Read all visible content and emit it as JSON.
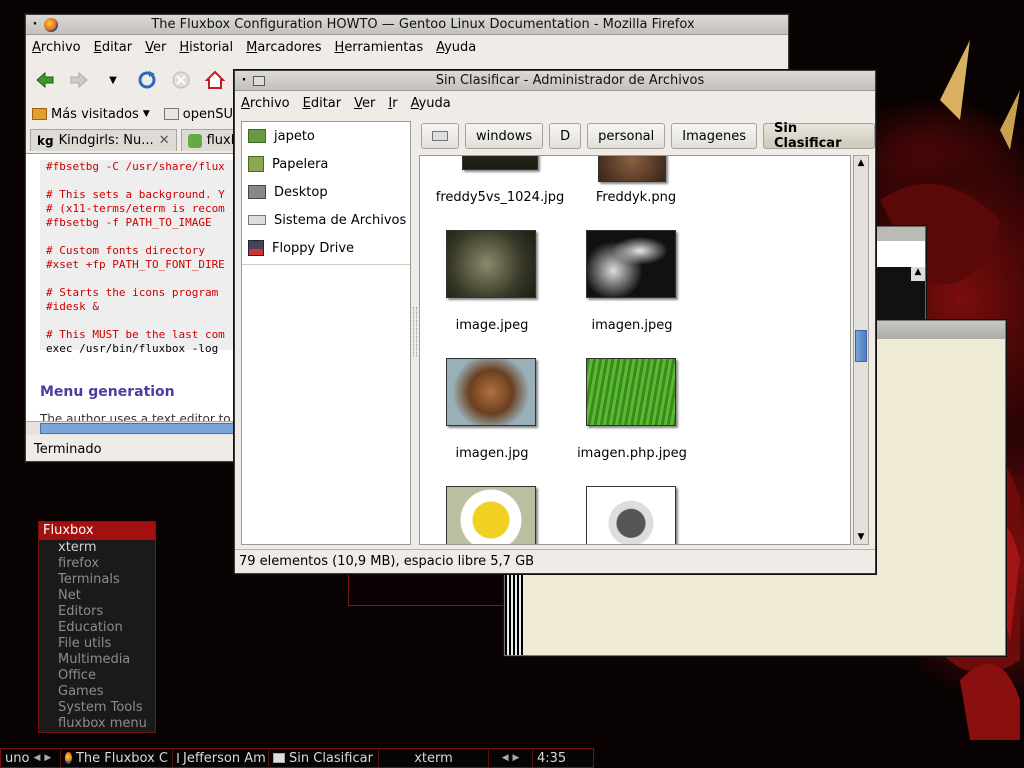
{
  "firefox": {
    "title": "The Fluxbox Configuration HOWTO — Gentoo Linux Documentation - Mozilla Firefox",
    "menu": [
      "Archivo",
      "Editar",
      "Ver",
      "Historial",
      "Marcadores",
      "Herramientas",
      "Ayuda"
    ],
    "bookmarks": [
      "Más visitados",
      "openSUS"
    ],
    "tabs": [
      "Kindgirls: Nu...",
      "fluxbo"
    ],
    "code_lines": [
      "#fbsetbg -C /usr/share/flux",
      "",
      "# This sets a background. Y",
      "# (x11-terms/eterm is recom",
      "#fbsetbg -f PATH_TO_IMAGE",
      "",
      "# Custom fonts directory",
      "#xset +fp PATH_TO_FONT_DIRE",
      "",
      "# Starts the icons program",
      "#idesk &",
      "",
      "# This MUST be the last com",
      "exec /usr/bin/fluxbox -log"
    ],
    "heading": "Menu generation",
    "paragraph": "The author uses a text editor to cr",
    "status": "Terminado"
  },
  "nautilus": {
    "title": "Sin Clasificar - Administrador de Archivos",
    "menu": [
      "Archivo",
      "Editar",
      "Ver",
      "Ir",
      "Ayuda"
    ],
    "places": [
      "japeto",
      "Papelera",
      "Desktop",
      "Sistema de Archivos",
      "Floppy Drive"
    ],
    "path": [
      "windows",
      "D",
      "personal",
      "Imagenes",
      "Sin Clasificar"
    ],
    "files": [
      {
        "name": "freddy5vs_1024.jpg"
      },
      {
        "name": "Freddyk.png"
      },
      {
        "name": "image.jpeg"
      },
      {
        "name": "imagen.jpeg"
      },
      {
        "name": "imagen.jpg"
      },
      {
        "name": "imagen.php.jpeg"
      }
    ],
    "status": "79 elementos (10,9 MB), espacio libre 5,7 GB"
  },
  "fluxbox_menu": {
    "title": "Fluxbox",
    "items": [
      "xterm",
      "firefox",
      "Terminals",
      "Net",
      "Editors",
      "Education",
      "File utils",
      "Multimedia",
      "Office",
      "Games",
      "System Tools",
      "fluxbox menu"
    ]
  },
  "taskbar": {
    "workspace": "uno",
    "tasks": [
      "The Fluxbox C",
      "Jefferson Am",
      "Sin Clasificar",
      "xterm"
    ],
    "clock": "4:35"
  },
  "colors": {
    "accent": "#a31010",
    "selection": "#7aa4dc",
    "link_heading": "#4a3fa0"
  }
}
